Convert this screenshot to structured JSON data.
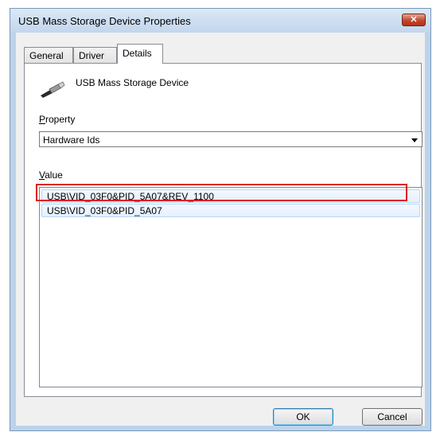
{
  "window": {
    "title": "USB Mass Storage Device Properties",
    "close_label": "✕"
  },
  "tabs": [
    {
      "label": "General",
      "active": false
    },
    {
      "label": "Driver",
      "active": false
    },
    {
      "label": "Details",
      "active": true
    }
  ],
  "details": {
    "device_name": "USB Mass Storage Device",
    "device_icon": "usb-plug-icon",
    "property_label_accel": "P",
    "property_label_rest": "roperty",
    "property_selected": "Hardware Ids",
    "value_label_accel": "V",
    "value_label_rest": "alue",
    "values": [
      "USB\\VID_03F0&PID_5A07&REV_1100",
      "USB\\VID_03F0&PID_5A07"
    ]
  },
  "buttons": {
    "ok": "OK",
    "cancel": "Cancel"
  },
  "colors": {
    "highlight_box": "#e0191f",
    "title_bar": "#c2d6ed",
    "close_button": "#c3462e"
  }
}
